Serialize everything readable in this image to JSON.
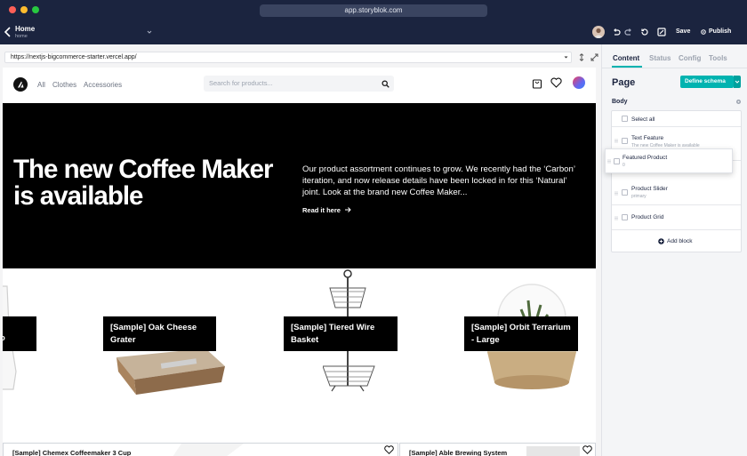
{
  "browser": {
    "url": "app.storyblok.com"
  },
  "header": {
    "story_title": "Home",
    "story_subtitle": "home",
    "save_label": "Save",
    "publish_label": "Publish"
  },
  "preview": {
    "url": "https://nextjs-bigcommerce-starter.vercel.app/"
  },
  "site": {
    "nav": [
      "All",
      "Clothes",
      "Accessories"
    ],
    "search_placeholder": "Search for products...",
    "hero": {
      "title": "The new Coffee Maker is available",
      "text": "Our product assortment continues to grow. We recently had the ‘Carbon’ iteration, and now release details have been locked in for this ‘Natural’ joint. Look at the brand new Coffee Maker...",
      "link": "Read it here"
    },
    "products": [
      {
        "label": "o"
      },
      {
        "label": "[Sample] Oak Cheese Grater"
      },
      {
        "label": "[Sample] Tiered Wire Basket"
      },
      {
        "label": "[Sample] Orbit Terrarium - Large"
      }
    ],
    "cards": [
      {
        "title": "[Sample] Chemex Coffeemaker 3 Cup"
      },
      {
        "title": "[Sample] Able Brewing System"
      }
    ]
  },
  "panel": {
    "tabs": [
      "Content",
      "Status",
      "Config",
      "Tools"
    ],
    "active_tab": "Content",
    "heading": "Page",
    "define_schema": "Define schema",
    "body_label": "Body",
    "select_all": "Select all",
    "blocks": [
      {
        "name": "Text Feature",
        "sub": "The new Coffee Maker is available"
      },
      {
        "name": "Product Slider",
        "sub": "primary"
      },
      {
        "name": "Product Grid",
        "sub": ""
      }
    ],
    "dragging_block": {
      "name": "Featured Product",
      "sub": "0"
    },
    "add_block": "Add block"
  },
  "colors": {
    "accent": "#00b3b0",
    "header_bg": "#1b243f"
  }
}
